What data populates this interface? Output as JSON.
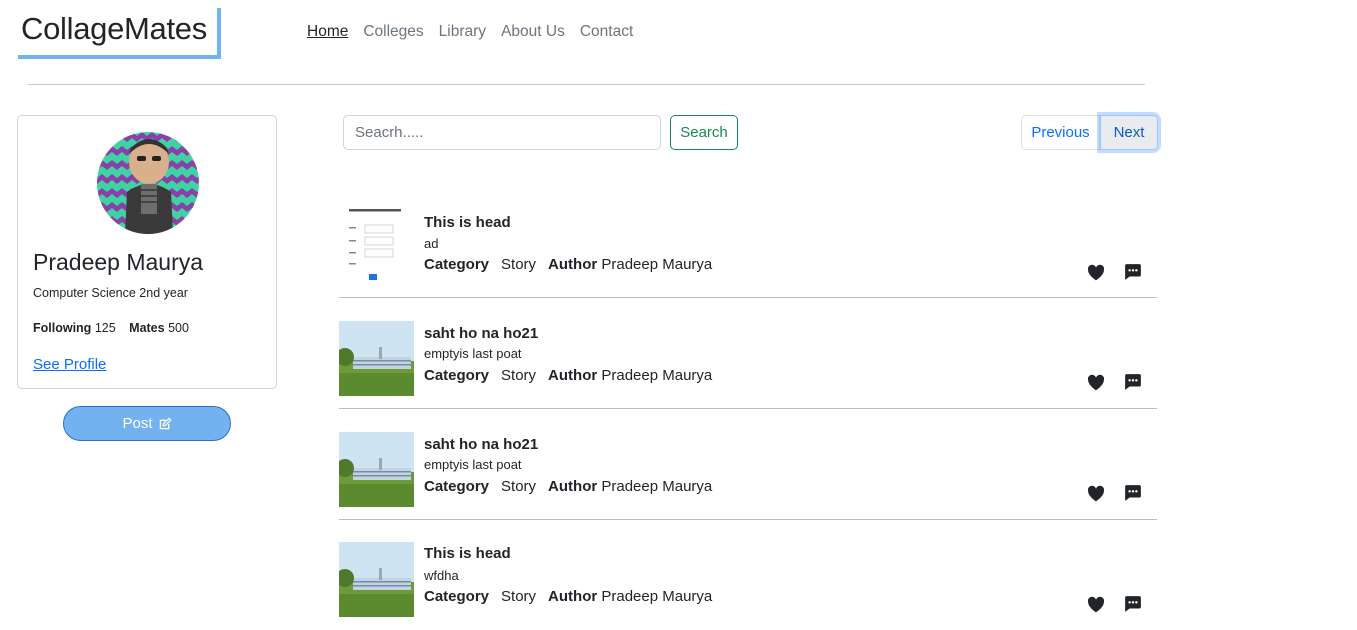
{
  "brand": {
    "name": "CollageMates"
  },
  "nav": [
    {
      "label": "Home",
      "active": true
    },
    {
      "label": "Colleges"
    },
    {
      "label": "Library"
    },
    {
      "label": "About Us"
    },
    {
      "label": "Contact"
    }
  ],
  "profile": {
    "name": "Pradeep Maurya",
    "department": "Computer Science 2nd year",
    "following_label": "Following",
    "following_count": "125",
    "mates_label": "Mates",
    "mates_count": "500",
    "see_profile": "See Profile",
    "post_button": "Post"
  },
  "search": {
    "placeholder": "Seacrh.....",
    "button": "Search"
  },
  "pagination": {
    "previous": "Previous",
    "next": "Next"
  },
  "labels": {
    "category": "Category",
    "author": "Author"
  },
  "posts": [
    {
      "title": "This is head",
      "description": "ad",
      "category": "Story",
      "author": "Pradeep Maurya",
      "thumbnail": "signup-form-screenshot"
    },
    {
      "title": "saht ho na ho21",
      "description": "emptyis last poat",
      "category": "Story",
      "author": "Pradeep Maurya",
      "thumbnail": "college-campus-photo"
    },
    {
      "title": "saht ho na ho21",
      "description": "emptyis last poat",
      "category": "Story",
      "author": "Pradeep Maurya",
      "thumbnail": "college-campus-photo"
    },
    {
      "title": "This is head",
      "description": "wfdha",
      "category": "Story",
      "author": "Pradeep Maurya",
      "thumbnail": "college-campus-photo"
    }
  ],
  "icons": {
    "like": "heart-icon",
    "comment": "comment-dots-icon",
    "edit": "pencil-square-icon"
  },
  "colors": {
    "accent": "#72b2f0",
    "link": "#0d6efd",
    "success": "#198754"
  }
}
